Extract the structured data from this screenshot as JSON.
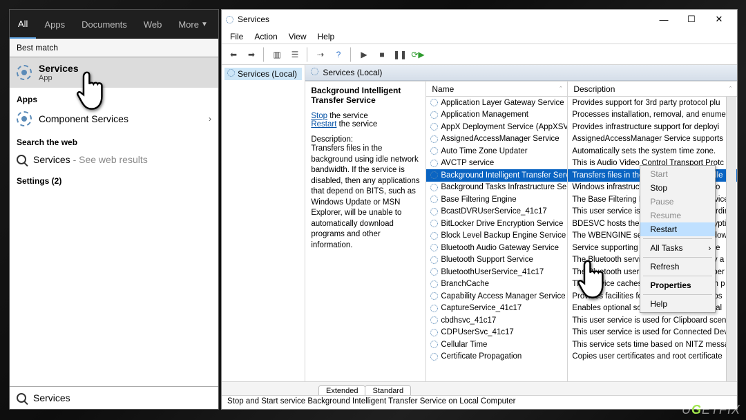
{
  "search": {
    "tabs": [
      "All",
      "Apps",
      "Documents",
      "Web",
      "More"
    ],
    "best_match_label": "Best match",
    "best": {
      "title": "Services",
      "subtitle": "App"
    },
    "apps_label": "Apps",
    "component": "Component Services",
    "web_label": "Search the web",
    "web_item_prefix": "Services",
    "web_item_suffix": " - See web results",
    "settings_label": "Settings (2)",
    "input_value": "Services"
  },
  "win": {
    "title": "Services",
    "menus": [
      "File",
      "Action",
      "View",
      "Help"
    ],
    "tree_root": "Services (Local)",
    "content_head": "Services (Local)",
    "detail": {
      "name": "Background Intelligent Transfer Service",
      "stop": "Stop",
      "stop_tail": " the service",
      "restart": "Restart",
      "restart_tail": " the service",
      "desc_label": "Description:",
      "desc": "Transfers files in the background using idle network bandwidth. If the service is disabled, then any applications that depend on BITS, such as Windows Update or MSN Explorer, will be unable to automatically download programs and other information."
    },
    "col_name": "Name",
    "col_desc": "Description",
    "items": [
      {
        "n": "Application Layer Gateway Service",
        "d": "Provides support for 3rd party protocol plu"
      },
      {
        "n": "Application Management",
        "d": "Processes installation, removal, and enume"
      },
      {
        "n": "AppX Deployment Service (AppXSVC)",
        "d": "Provides infrastructure support for deployi"
      },
      {
        "n": "AssignedAccessManager Service",
        "d": "AssignedAccessManager Service supports"
      },
      {
        "n": "Auto Time Zone Updater",
        "d": "Automatically sets the system time zone."
      },
      {
        "n": "AVCTP service",
        "d": "This is Audio Video Control Transport Protc"
      },
      {
        "n": "Background Intelligent Transfer Service",
        "d": "Transfers files in the background using idle",
        "sel": true
      },
      {
        "n": "Background Tasks Infrastructure Service",
        "d": "Windows infrastructure service that contro"
      },
      {
        "n": "Base Filtering Engine",
        "d": "The Base Filtering Engine (BFE) is a service t"
      },
      {
        "n": "BcastDVRUserService_41c17",
        "d": "This user service is used for Game Recordin"
      },
      {
        "n": "BitLocker Drive Encryption Service",
        "d": "BDESVC hosts the BitLocker Drive Encryptio"
      },
      {
        "n": "Block Level Backup Engine Service",
        "d": "The WBENGINE service is used by Windows"
      },
      {
        "n": "Bluetooth Audio Gateway Service",
        "d": "Service supporting the audio gateway role"
      },
      {
        "n": "Bluetooth Support Service",
        "d": "The Bluetooth service supports discovery a"
      },
      {
        "n": "BluetoothUserService_41c17",
        "d": "The Bluetooth user service supports proper"
      },
      {
        "n": "BranchCache",
        "d": "This service caches network content from p"
      },
      {
        "n": "Capability Access Manager Service",
        "d": "Provides facilities for managing UWP apps"
      },
      {
        "n": "CaptureService_41c17",
        "d": "Enables optional screen capture functional"
      },
      {
        "n": "cbdhsvc_41c17",
        "d": "This user service is used for Clipboard scen"
      },
      {
        "n": "CDPUserSvc_41c17",
        "d": "This user service is used for Connected Dev"
      },
      {
        "n": "Cellular Time",
        "d": "This service sets time based on NITZ messa"
      },
      {
        "n": "Certificate Propagation",
        "d": "Copies user certificates and root certificate"
      }
    ],
    "tabs": [
      "Extended",
      "Standard"
    ],
    "status": "Stop and Start service Background Intelligent Transfer Service on Local Computer"
  },
  "ctx": {
    "items": [
      {
        "l": "Start",
        "dim": true
      },
      {
        "l": "Stop"
      },
      {
        "l": "Pause",
        "dim": true
      },
      {
        "l": "Resume",
        "dim": true
      },
      {
        "l": "Restart",
        "hi": true
      },
      {
        "sep": true
      },
      {
        "l": "All Tasks",
        "sub": true
      },
      {
        "sep": true
      },
      {
        "l": "Refresh"
      },
      {
        "sep": true
      },
      {
        "l": "Properties",
        "bold": true
      },
      {
        "sep": true
      },
      {
        "l": "Help"
      }
    ]
  },
  "watermark": "UGETFIX"
}
